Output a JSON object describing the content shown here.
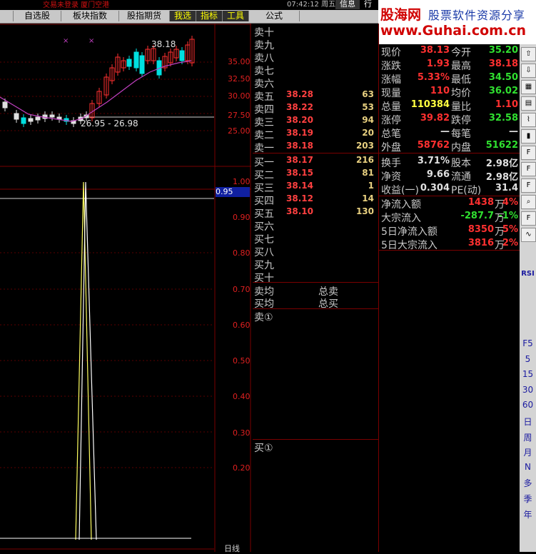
{
  "topbar": {
    "info_text": "交易未登录  厦门空港",
    "clock": "07:42:12 周五",
    "tabs_right": [
      "信息",
      "行"
    ],
    "menu": [
      {
        "label": "自选股",
        "highlight": false
      },
      {
        "label": "板块指数",
        "highlight": false
      },
      {
        "label": "股指期货",
        "highlight": false
      },
      {
        "label": "我选",
        "highlight": true
      },
      {
        "label": "指标",
        "highlight": true
      },
      {
        "label": "工具",
        "highlight": true
      },
      {
        "label": "公式",
        "highlight": false
      }
    ]
  },
  "logo": {
    "name": "股海网",
    "tagline": "股票软件资源分享",
    "url": "www.Guhai.com.cn"
  },
  "kline": {
    "high_label": "38.18",
    "range_label": "26.95 - 26.98",
    "y_ticks": [
      "35.00",
      "32.50",
      "30.00",
      "27.50",
      "25.00"
    ]
  },
  "indicator": {
    "current_value": "0.95",
    "y_ticks": [
      "1.00",
      "0.90",
      "0.80",
      "0.70",
      "0.60",
      "0.50",
      "0.40",
      "0.30",
      "0.20"
    ],
    "x_label": "日线"
  },
  "orderbook": {
    "sells": [
      {
        "label": "卖十",
        "price": "",
        "vol": ""
      },
      {
        "label": "卖九",
        "price": "",
        "vol": ""
      },
      {
        "label": "卖八",
        "price": "",
        "vol": ""
      },
      {
        "label": "卖七",
        "price": "",
        "vol": ""
      },
      {
        "label": "卖六",
        "price": "",
        "vol": ""
      },
      {
        "label": "卖五",
        "price": "38.28",
        "vol": "63"
      },
      {
        "label": "卖四",
        "price": "38.22",
        "vol": "53"
      },
      {
        "label": "卖三",
        "price": "38.20",
        "vol": "94"
      },
      {
        "label": "卖二",
        "price": "38.19",
        "vol": "20"
      },
      {
        "label": "卖一",
        "price": "38.18",
        "vol": "203"
      }
    ],
    "buys": [
      {
        "label": "买一",
        "price": "38.17",
        "vol": "216"
      },
      {
        "label": "买二",
        "price": "38.15",
        "vol": "81"
      },
      {
        "label": "买三",
        "price": "38.14",
        "vol": "1"
      },
      {
        "label": "买四",
        "price": "38.12",
        "vol": "14"
      },
      {
        "label": "买五",
        "price": "38.10",
        "vol": "130"
      },
      {
        "label": "买六",
        "price": "",
        "vol": ""
      },
      {
        "label": "买七",
        "price": "",
        "vol": ""
      },
      {
        "label": "买八",
        "price": "",
        "vol": ""
      },
      {
        "label": "买九",
        "price": "",
        "vol": ""
      },
      {
        "label": "买十",
        "price": "",
        "vol": ""
      }
    ],
    "sell_avg_label": "卖均",
    "buy_avg_label": "买均",
    "total_sell_label": "总卖",
    "total_buy_label": "总买",
    "sell_queue_label": "卖①",
    "buy_queue_label": "买①"
  },
  "quote": {
    "rows": [
      {
        "l1": "现价",
        "v1": "38.13",
        "c1": "red",
        "l2": "今开",
        "v2": "35.20",
        "c2": "green"
      },
      {
        "l1": "涨跌",
        "v1": "1.93",
        "c1": "red",
        "l2": "最高",
        "v2": "38.18",
        "c2": "red"
      },
      {
        "l1": "涨幅",
        "v1": "5.33%",
        "c1": "red",
        "l2": "最低",
        "v2": "34.50",
        "c2": "green"
      },
      {
        "l1": "现量",
        "v1": "110",
        "c1": "red",
        "l2": "均价",
        "v2": "36.02",
        "c2": "green"
      },
      {
        "l1": "总量",
        "v1": "110384",
        "c1": "yellow",
        "l2": "量比",
        "v2": "1.10",
        "c2": "red"
      },
      {
        "l1": "涨停",
        "v1": "39.82",
        "c1": "red",
        "l2": "跌停",
        "v2": "32.58",
        "c2": "green"
      },
      {
        "l1": "总笔",
        "v1": "—",
        "c1": "white",
        "l2": "每笔",
        "v2": "—",
        "c2": "white"
      },
      {
        "l1": "外盘",
        "v1": "58762",
        "c1": "red",
        "l2": "内盘",
        "v2": "51622",
        "c2": "green"
      },
      {
        "l1": "换手",
        "v1": "3.71%",
        "c1": "white",
        "l2": "股本",
        "v2": "2.98亿",
        "c2": "white"
      },
      {
        "l1": "净资",
        "v1": "9.66",
        "c1": "white",
        "l2": "流通",
        "v2": "2.98亿",
        "c2": "white"
      },
      {
        "l1": "收益(一)",
        "v1": "0.304",
        "c1": "white",
        "l2": "PE(动)",
        "v2": "31.4",
        "c2": "white"
      }
    ],
    "flows": [
      {
        "label": "净流入额",
        "amount": "1438",
        "unit": "万",
        "pct": "4%",
        "color": "red"
      },
      {
        "label": "大宗流入",
        "amount": "-287.7",
        "unit": "万",
        "pct": "-1%",
        "color": "green"
      },
      {
        "label": "5日净流入额",
        "amount": "8350",
        "unit": "万",
        "pct": "5%",
        "color": "red"
      },
      {
        "label": "5日大宗流入",
        "amount": "3816",
        "unit": "万",
        "pct": "2%",
        "color": "red"
      }
    ]
  },
  "toolbar": {
    "icons": [
      "arrow-up-icon",
      "arrow-down-icon",
      "grid-icon",
      "table-icon",
      "line-chart-icon",
      "candle-icon",
      "f10-icon",
      "f10-icon-2",
      "fig-icon",
      "zoom-icon",
      "f10-icon-3",
      "wave-icon"
    ],
    "rsi_label": "RSI",
    "periods": [
      "F5",
      "5",
      "15",
      "30",
      "60",
      "日",
      "周",
      "月",
      "N",
      "多",
      "季",
      "年"
    ]
  }
}
